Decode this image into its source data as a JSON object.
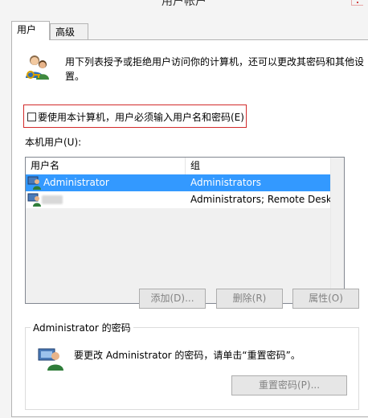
{
  "window": {
    "title": "用户帐户"
  },
  "tabs": [
    {
      "label": "用户",
      "active": true
    },
    {
      "label": "高级",
      "active": false
    }
  ],
  "intro": {
    "text": "用下列表授予或拒绝用户访问你的计算机，还可以更改其密码和其他设置。"
  },
  "require_login": {
    "label": "要使用本计算机，用户必须输入用户名和密码(E)",
    "checked": false
  },
  "users_section": {
    "label": "本机用户(U):",
    "columns": {
      "name": "用户名",
      "group": "组"
    },
    "rows": [
      {
        "name": "Administrator",
        "group": "Administrators",
        "selected": true
      },
      {
        "name": "",
        "group": "Administrators; Remote Deskt...",
        "selected": false
      }
    ]
  },
  "buttons": {
    "add": "添加(D)...",
    "remove": "删除(R)",
    "properties": "属性(O)"
  },
  "password_group": {
    "title": "Administrator 的密码",
    "text": "要更改 Administrator 的密码，请单击“重置密码”。",
    "reset_button": "重置密码(P)..."
  },
  "colors": {
    "selection": "#3399ff",
    "highlight_border": "#d22a2a",
    "disabled_text": "#838383"
  },
  "icons": {
    "intro": "users-key-icon",
    "user_row": "user-icon",
    "password": "user-password-icon"
  }
}
